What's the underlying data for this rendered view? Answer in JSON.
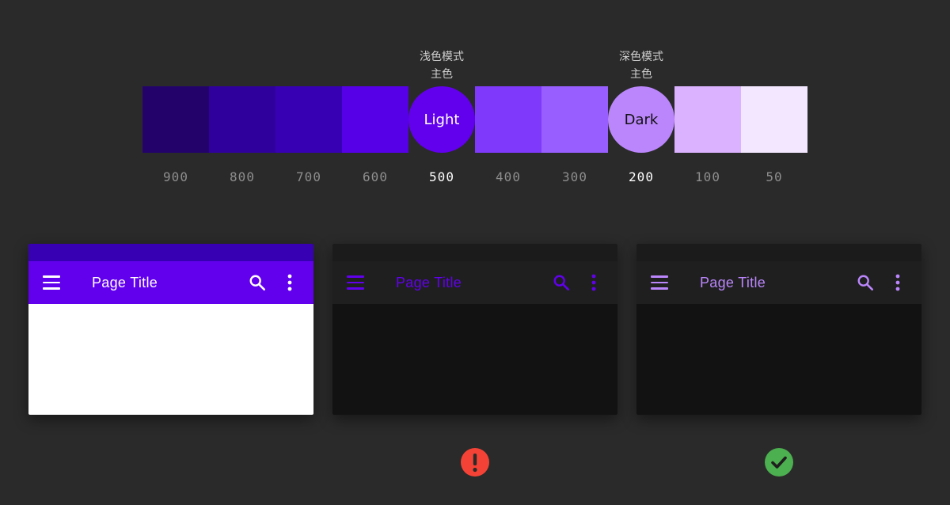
{
  "palette": {
    "swatches": [
      {
        "shade": "900",
        "color": "#23036a",
        "highlight": false
      },
      {
        "shade": "800",
        "color": "#30009c",
        "highlight": false
      },
      {
        "shade": "700",
        "color": "#3700b3",
        "highlight": false
      },
      {
        "shade": "600",
        "color": "#5600e8",
        "highlight": false
      },
      {
        "shade": "500",
        "color": "#6200ee",
        "highlight": true,
        "circle_label": "Light",
        "label_color": "#ffffff"
      },
      {
        "shade": "400",
        "color": "#7f39fb",
        "highlight": false
      },
      {
        "shade": "300",
        "color": "#985eff",
        "highlight": false
      },
      {
        "shade": "200",
        "color": "#bb86fc",
        "highlight": true,
        "circle_label": "Dark",
        "label_color": "#111111"
      },
      {
        "shade": "100",
        "color": "#dbb2ff",
        "highlight": false
      },
      {
        "shade": "50",
        "color": "#f2e7fe",
        "highlight": false
      }
    ],
    "light_caption": {
      "line1": "浅色模式",
      "line2": "主色"
    },
    "dark_caption": {
      "line1": "深色模式",
      "line2": "主色"
    }
  },
  "cards": [
    {
      "variant": "light",
      "status_color": "#3700b3",
      "appbar_color": "#6200ee",
      "content_color": "#ffffff",
      "title": "Page Title",
      "fg_color": "#ffffff",
      "menu_icon": "menu-icon",
      "search_icon": "search-icon",
      "more_icon": "more-vert-icon"
    },
    {
      "variant": "dark-wrong",
      "status_color": "#1b1b1b",
      "appbar_color": "#1f1f1f",
      "content_color": "#121212",
      "title": "Page Title",
      "fg_color": "#6200ee",
      "menu_icon": "menu-icon",
      "search_icon": "search-icon",
      "more_icon": "more-vert-icon"
    },
    {
      "variant": "dark-correct",
      "status_color": "#1b1b1b",
      "appbar_color": "#1f1f1f",
      "content_color": "#121212",
      "title": "Page Title",
      "fg_color": "#bb86fc",
      "menu_icon": "menu-icon",
      "search_icon": "search-icon",
      "more_icon": "more-vert-icon"
    }
  ],
  "indicators": {
    "error": {
      "icon": "error-exclamation-icon",
      "color": "#f44336"
    },
    "success": {
      "icon": "check-icon",
      "color": "#4caf50"
    }
  }
}
